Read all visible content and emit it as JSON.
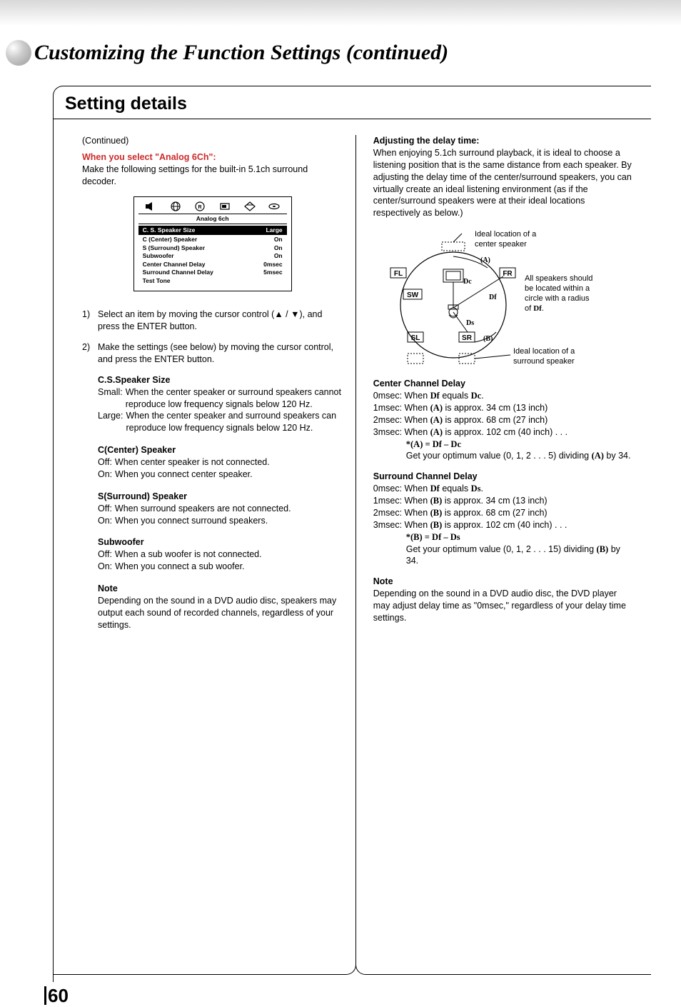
{
  "header": {
    "title": "Customizing the Function Settings (continued)"
  },
  "section_title": "Setting details",
  "left": {
    "continued": "(Continued)",
    "analog_heading": "When you select \"Analog 6Ch\":",
    "analog_text": "Make the following settings for the built-in 5.1ch surround decoder.",
    "osd": {
      "title": "Analog 6ch",
      "rows": [
        {
          "l": "C. S. Speaker Size",
          "r": "Large",
          "hl": true
        },
        {
          "l": "C (Center) Speaker",
          "r": "On"
        },
        {
          "l": "S (Surround) Speaker",
          "r": "On"
        },
        {
          "l": "Subwoofer",
          "r": "On"
        },
        {
          "l": "Center Channel Delay",
          "r": "0msec"
        },
        {
          "l": "Surround Channel Delay",
          "r": "5msec"
        },
        {
          "l": "Test Tone",
          "r": ""
        }
      ]
    },
    "step1": "Select an item by moving the cursor control (▲ / ▼), and press the ENTER button.",
    "step2": "Make the settings (see below) by moving the cursor control, and press the ENTER button.",
    "css": {
      "h": "C.S.Speaker Size",
      "small": "When the center speaker or surround speakers cannot reproduce low frequency signals below 120 Hz.",
      "large": "When the center speaker and surround speakers can reproduce low frequency signals below 120 Hz."
    },
    "center": {
      "h": "C(Center) Speaker",
      "off": "When center speaker is not connected.",
      "on": "When you connect center speaker."
    },
    "surround": {
      "h": "S(Surround) Speaker",
      "off": "When surround speakers are not connected.",
      "on": "When you connect surround speakers."
    },
    "sub": {
      "h": "Subwoofer",
      "off": "When a sub woofer is not connected.",
      "on": "When you connect a sub woofer."
    },
    "note_h": "Note",
    "note": "Depending on the sound in a DVD audio disc, speakers may output each sound of recorded channels, regardless of your settings."
  },
  "right": {
    "adj_h": "Adjusting the delay time:",
    "adj_text": "When enjoying 5.1ch surround playback, it is ideal to choose a listening position that is the same distance from each speaker. By adjusting the delay time of the center/surround speakers, you can virtually create an ideal listening environment (as if the center/surround speakers were at their ideal locations respectively as below.)",
    "diag": {
      "ideal_center": "Ideal location of a center speaker",
      "all_spk": "All speakers should be located within a circle with a radius of ",
      "df": "Df",
      "ideal_surr": "Ideal location of a surround speaker"
    },
    "ccd": {
      "h": "Center Channel Delay",
      "l0a": "0msec: When ",
      "l0b": " equals ",
      "l1a": "1msec: When ",
      "l1b": " is approx. 34 cm (13 inch)",
      "l2a": "2msec: When ",
      "l2b": " is approx. 68 cm (27 inch)",
      "l3a": "3msec: When ",
      "l3b": " is approx. 102 cm (40 inch) . . .",
      "formula": "*(A) = Df – Dc",
      "opt1": "Get your optimum value (0, 1, 2 . . . 5) dividing ",
      "opt2": " by 34."
    },
    "scd": {
      "h": "Surround Channel Delay",
      "l0a": "0msec: When ",
      "l0b": " equals ",
      "l1a": "1msec: When ",
      "l1b": " is approx. 34 cm (13 inch)",
      "l2a": "2msec: When ",
      "l2b": " is approx. 68 cm (27 inch)",
      "l3a": "3msec: When ",
      "l3b": " is approx. 102 cm (40 inch) . . .",
      "formula": "*(B) = Df – Ds",
      "opt1": "Get your optimum value (0, 1, 2 . . . 15) dividing ",
      "opt2": " by 34."
    },
    "note_h": "Note",
    "note": "Depending on the sound in a DVD audio disc, the DVD player may adjust delay time as \"0msec,\" regardless of your delay time settings."
  },
  "page_number": "60"
}
